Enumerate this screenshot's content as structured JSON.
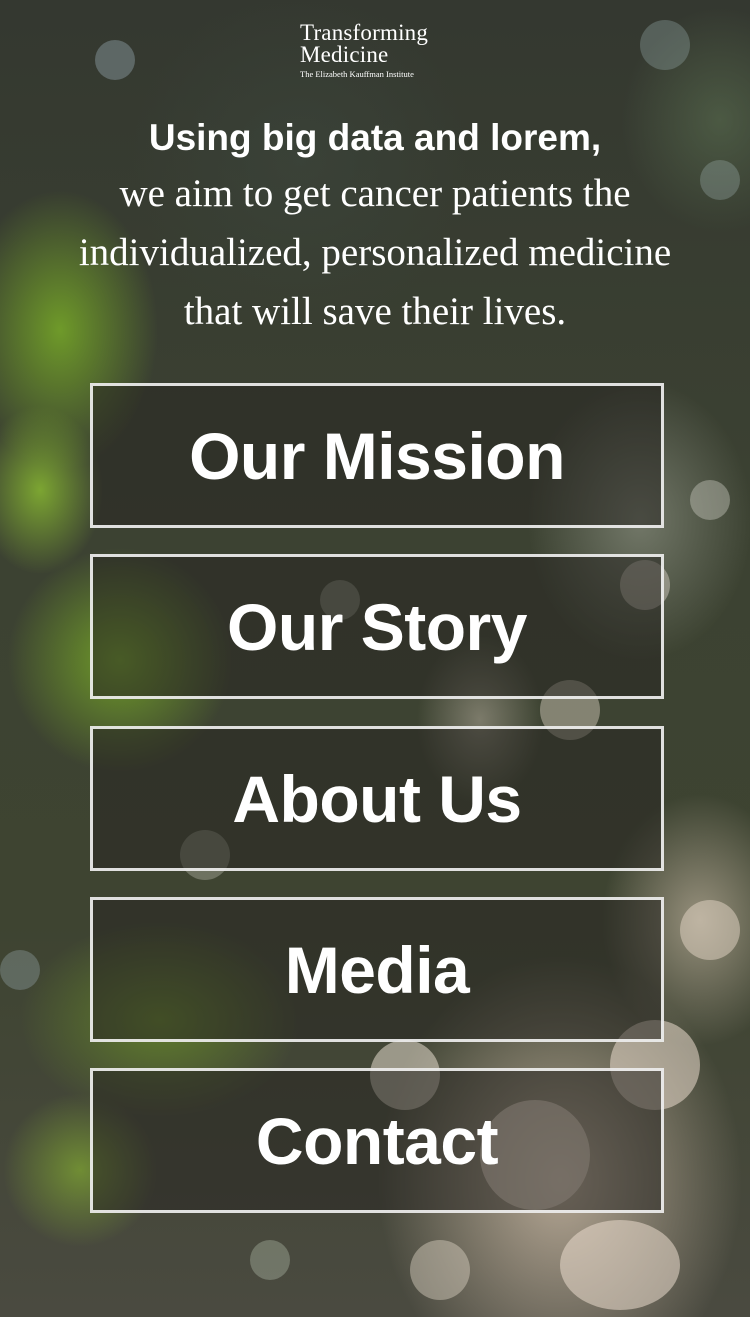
{
  "header": {
    "logo_line1": "Transforming",
    "logo_line2": "Medicine",
    "logo_sub": "The Elizabeth Kauffman Institute"
  },
  "tagline": {
    "lead": "Using big data and lorem,",
    "body": "we aim to get cancer patients the individualized, personalized medicine that will save their lives."
  },
  "nav": {
    "items": [
      {
        "label": "Our Mission"
      },
      {
        "label": "Our Story"
      },
      {
        "label": "About Us"
      },
      {
        "label": "Media"
      },
      {
        "label": "Contact"
      }
    ]
  },
  "colors": {
    "text": "#ffffff",
    "background": "#3d4030",
    "button_border": "#ffffff"
  }
}
